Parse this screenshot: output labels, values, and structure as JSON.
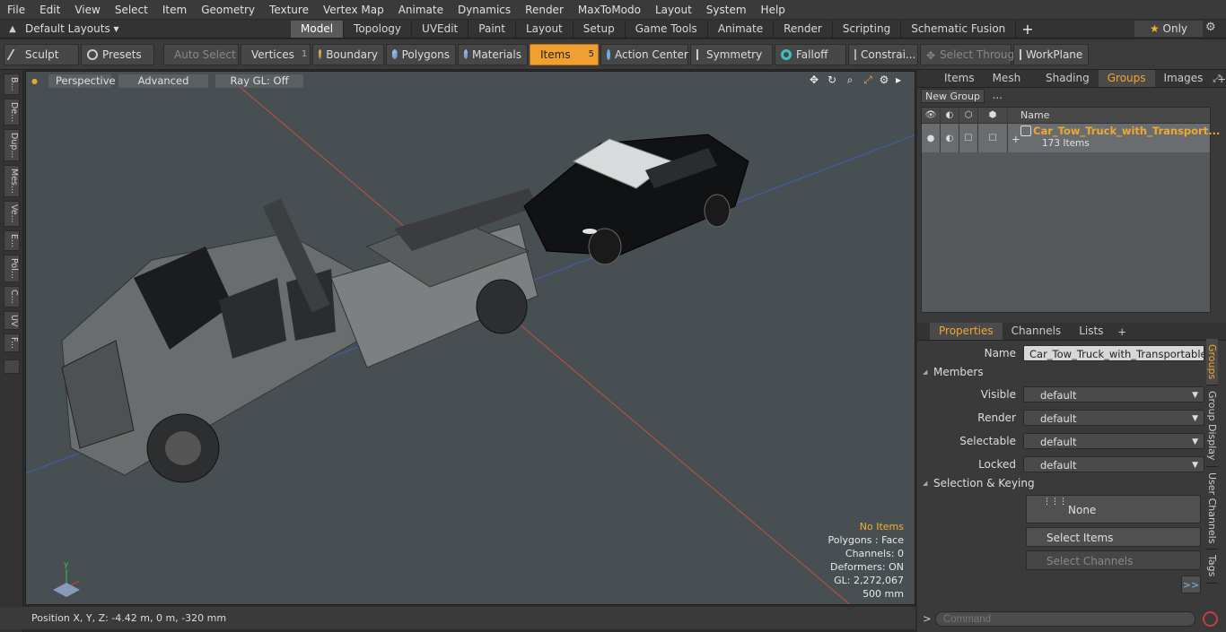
{
  "menu": [
    "File",
    "Edit",
    "View",
    "Select",
    "Item",
    "Geometry",
    "Texture",
    "Vertex Map",
    "Animate",
    "Dynamics",
    "Render",
    "MaxToModo",
    "Layout",
    "System",
    "Help"
  ],
  "layout_selector": "Default Layouts",
  "mode_tabs": [
    {
      "label": "Model",
      "active": true
    },
    {
      "label": "Topology"
    },
    {
      "label": "UVEdit"
    },
    {
      "label": "Paint"
    },
    {
      "label": "Layout"
    },
    {
      "label": "Setup"
    },
    {
      "label": "Game Tools"
    },
    {
      "label": "Animate"
    },
    {
      "label": "Render"
    },
    {
      "label": "Scripting"
    },
    {
      "label": "Schematic Fusion"
    }
  ],
  "only_label": "Only",
  "toolbar": {
    "sculpt": "Sculpt",
    "presets": "Presets",
    "auto_select": "Auto Select",
    "vertices": "Vertices",
    "vertices_count": "1",
    "boundary": "Boundary",
    "polygons": "Polygons",
    "materials": "Materials",
    "items": "Items",
    "items_count": "5",
    "action_center": "Action Center",
    "symmetry": "Symmetry",
    "falloff": "Falloff",
    "constraints": "Constrai...",
    "select_through": "Select Through",
    "workplane": "WorkPlane"
  },
  "left_tools": [
    "B...",
    "De...",
    "Dup...",
    "Mes...",
    "Ve...",
    "E...",
    "Pol...",
    "C...",
    "UV",
    "F..."
  ],
  "viewport": {
    "perspective": "Perspective",
    "advanced": "Advanced",
    "raygl": "Ray GL: Off",
    "info": {
      "selection": "No Items",
      "polygons": "Polygons : Face",
      "channels": "Channels: 0",
      "deformers": "Deformers: ON",
      "gl": "GL: 2,272,067",
      "scale": "500 mm"
    }
  },
  "status": {
    "position": "Position X, Y, Z:  -4.42 m, 0 m, -320 mm"
  },
  "panel_tabs": [
    "Items",
    "Mesh ...",
    "Shading",
    "Groups",
    "Images"
  ],
  "groups": {
    "new_group": "New Group",
    "name_header": "Name",
    "group_name": "Car_Tow_Truck_with_Transport...",
    "group_count": "173 Items"
  },
  "props_tabs": [
    "Properties",
    "Channels",
    "Lists"
  ],
  "properties": {
    "name_label": "Name",
    "name_value": "Car_Tow_Truck_with_Transportable_C",
    "members": "Members",
    "visible_label": "Visible",
    "visible_value": "default",
    "render_label": "Render",
    "render_value": "default",
    "selectable_label": "Selectable",
    "selectable_value": "default",
    "locked_label": "Locked",
    "locked_value": "default",
    "sel_keying": "Selection & Keying",
    "none": "None",
    "select_items": "Select Items",
    "select_channels": "Select Channels",
    "more": ">>"
  },
  "side_tabs": [
    "Groups",
    "Group Display",
    "User Channels",
    "Tags"
  ],
  "command_placeholder": "Command"
}
